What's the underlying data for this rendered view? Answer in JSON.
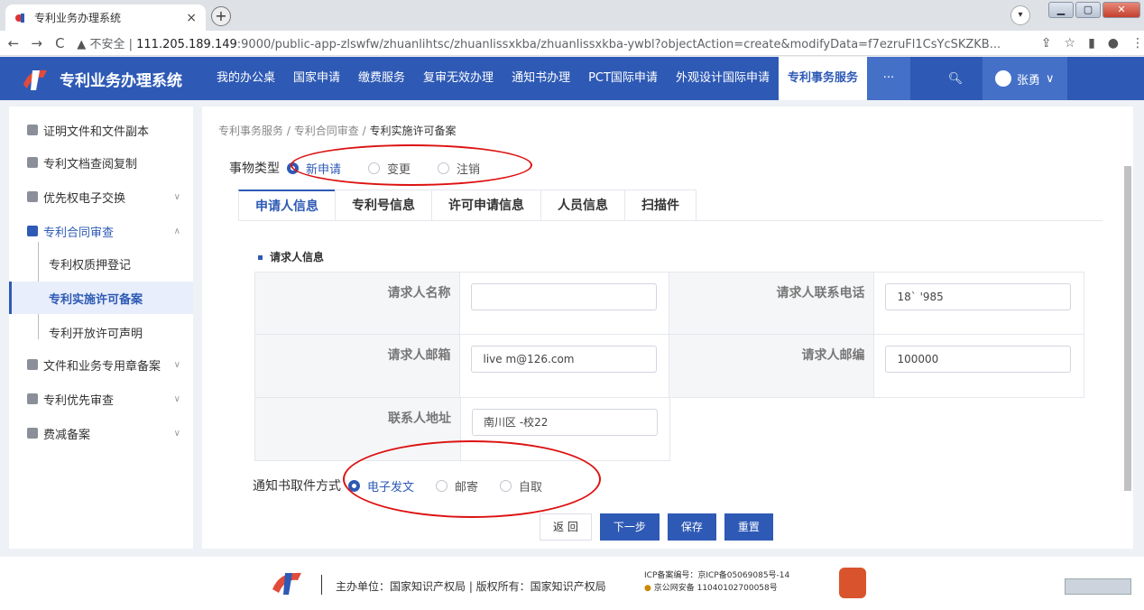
{
  "browser": {
    "tab_title": "专利业务办理系统",
    "tab_close": "×",
    "new_tab": "+",
    "not_secure": "不安全",
    "url_host": "111.205.189.149",
    "url_rest": ":9000/public-app-zlswfw/zhuanlihtsc/zhuanlissxkba/zhuanlissxkba-ywbl?objectAction=create&modifyData=f7ezruFl1CsYcSKZKB..."
  },
  "app": {
    "title": "专利业务办理系统",
    "nav": [
      "我的办公桌",
      "国家申请",
      "缴费服务",
      "复审无效办理",
      "通知书办理",
      "PCT国际申请",
      "外观设计国际申请",
      "专利事务服务"
    ],
    "nav_more": "···",
    "user": "张勇"
  },
  "sidebar": {
    "items": [
      {
        "label": "证明文件和文件副本"
      },
      {
        "label": "专利文档查阅复制"
      },
      {
        "label": "优先权电子交换"
      },
      {
        "label": "专利合同审查"
      },
      {
        "label": "专利权质押登记"
      },
      {
        "label": "专利实施许可备案"
      },
      {
        "label": "专利开放许可声明"
      },
      {
        "label": "文件和业务专用章备案"
      },
      {
        "label": "专利优先审查"
      },
      {
        "label": "费减备案"
      }
    ]
  },
  "breadcrumb": {
    "a": "专利事务服务",
    "sep": "/",
    "b": "专利合同审查",
    "c": "专利实施许可备案"
  },
  "transaction": {
    "label": "事物类型",
    "options": [
      "新申请",
      "变更",
      "注销"
    ]
  },
  "tabs": [
    "申请人信息",
    "专利号信息",
    "许可申请信息",
    "人员信息",
    "扫描件"
  ],
  "section_title": "请求人信息",
  "form": {
    "name_label": "请求人名称",
    "name_value": "",
    "phone_label": "请求人联系电话",
    "phone_value": "18`     '985",
    "email_label": "请求人邮箱",
    "email_value": "live   m@126.com",
    "zip_label": "请求人邮编",
    "zip_value": "100000",
    "address_label": "联系人地址",
    "address_value": "南川区           -校22"
  },
  "notice": {
    "label": "通知书取件方式",
    "options": [
      "电子发文",
      "邮寄",
      "自取"
    ]
  },
  "buttons": {
    "back": "返 回",
    "next": "下一步",
    "save": "保存",
    "reset": "重置"
  },
  "footer": {
    "org": "主办单位：国家知识产权局 | 版权所有：国家知识产权局",
    "icp": "ICP备案编号：京ICP备05069085号-14",
    "police": "京公网安备 11040102700058号"
  },
  "colors": {
    "brand": "#2e5ab5",
    "annotation": "#dd1111"
  }
}
